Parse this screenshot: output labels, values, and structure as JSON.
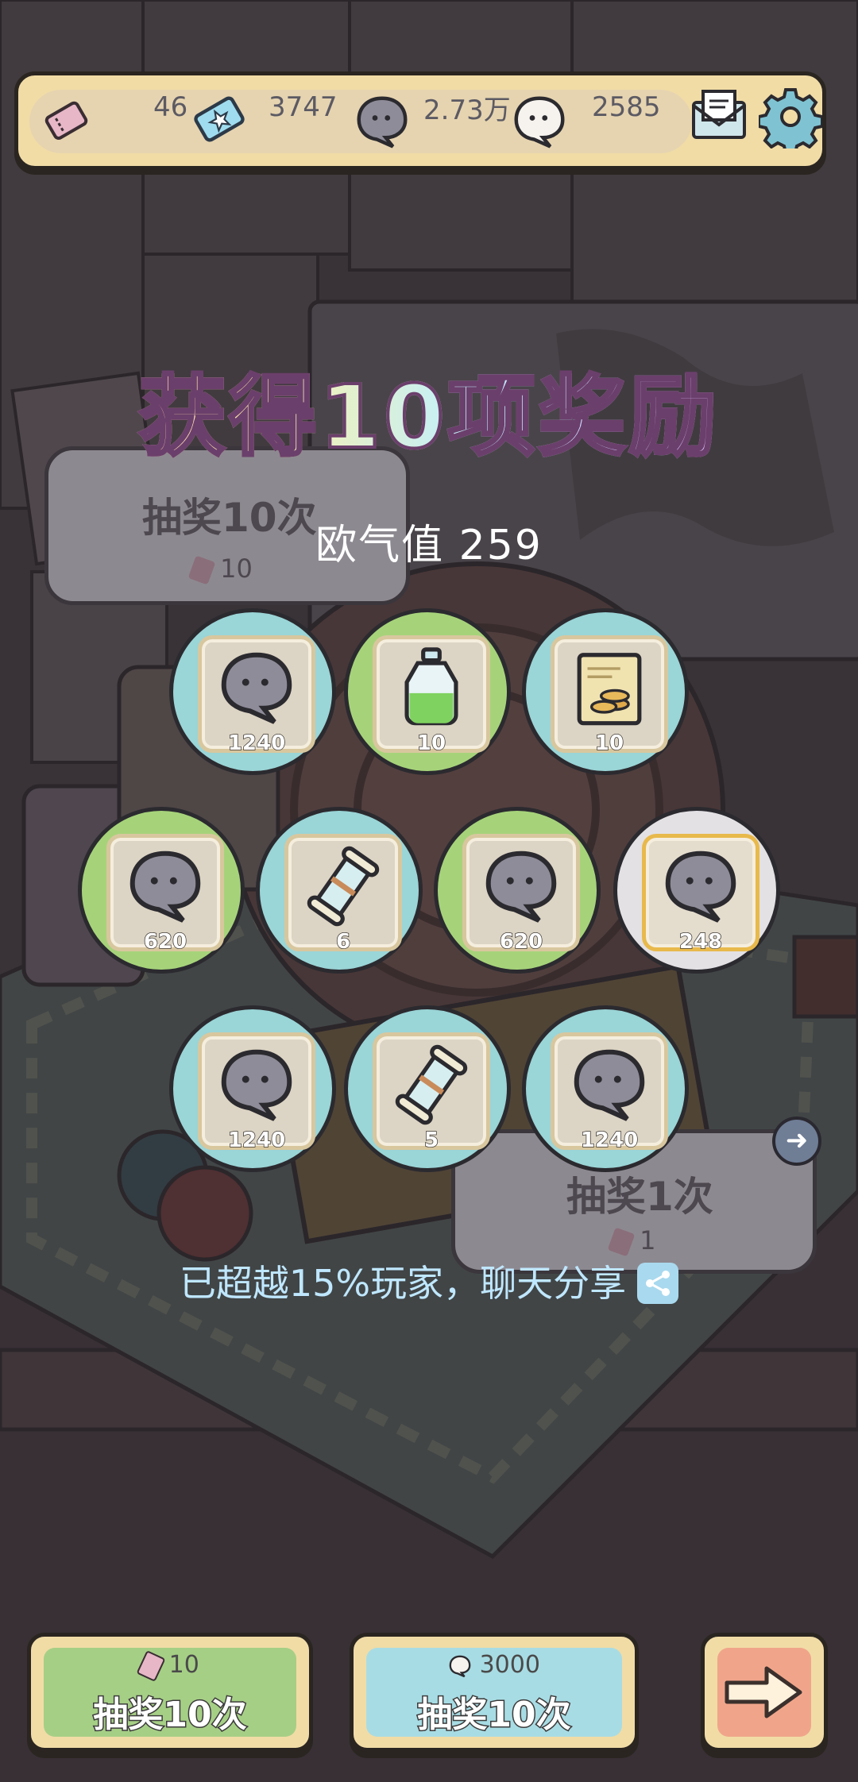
{
  "resources": [
    {
      "name": "ticket",
      "value": "46"
    },
    {
      "name": "blue-ticket",
      "value": "3747"
    },
    {
      "name": "gray-bubble",
      "value": "2.73万"
    },
    {
      "name": "white-bubble",
      "value": "2585"
    }
  ],
  "background_panels": {
    "left_title": "抽奖10次",
    "left_cost": "10",
    "right_title": "抽奖1次",
    "right_cost": "1"
  },
  "title": "获得10项奖励",
  "luck": "欧气值 259",
  "rewards": [
    {
      "item": "gray-bubble",
      "count": "1240",
      "ring": "#9ad5d7"
    },
    {
      "item": "green-potion",
      "count": "10",
      "ring": "#a6d37a"
    },
    {
      "item": "coin-card",
      "count": "10",
      "ring": "#9ad5d7"
    },
    {
      "item": "gray-bubble",
      "count": "620",
      "ring": "#a6d37a"
    },
    {
      "item": "scroll",
      "count": "6",
      "ring": "#9ad5d7"
    },
    {
      "item": "gray-bubble",
      "count": "620",
      "ring": "#a6d37a"
    },
    {
      "item": "gray-bubble",
      "count": "248",
      "ring": "#e3e1e4"
    },
    {
      "item": "gray-bubble",
      "count": "1240",
      "ring": "#9ad5d7"
    },
    {
      "item": "scroll",
      "count": "5",
      "ring": "#9ad5d7"
    },
    {
      "item": "gray-bubble",
      "count": "1240",
      "ring": "#9ad5d7"
    }
  ],
  "share": "已超越15%玩家，聊天分享",
  "buttons": {
    "ticket_draw": {
      "cost": "10",
      "label": "抽奖10次",
      "color": "#a6cf86"
    },
    "bubble_draw": {
      "cost": "3000",
      "label": "抽奖10次",
      "color": "#a8dce4"
    },
    "next": {
      "icon": "arrow-right-icon",
      "color": "#f0a58a"
    }
  }
}
